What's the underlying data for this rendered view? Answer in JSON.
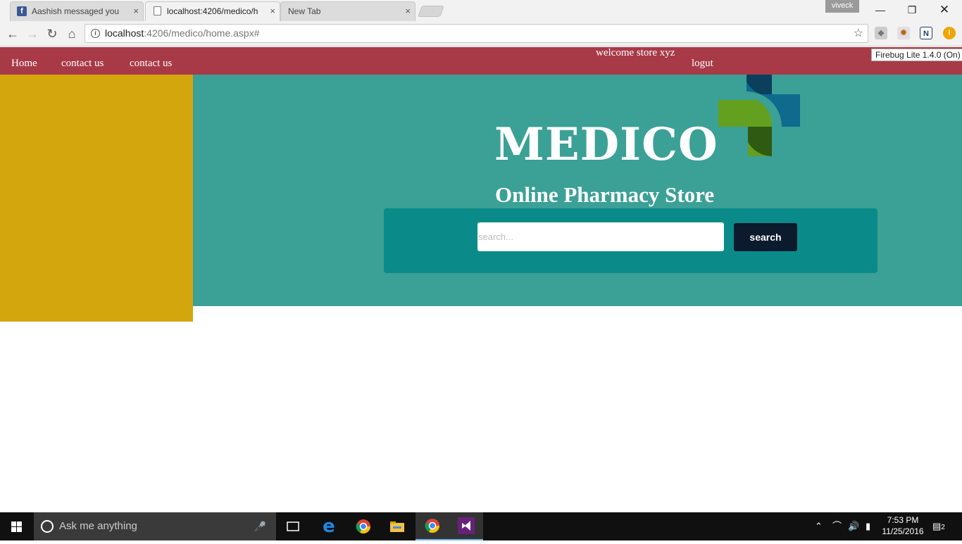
{
  "browser": {
    "tabs": [
      {
        "label": "Aashish messaged you",
        "icon": "facebook-icon"
      },
      {
        "label": "localhost:4206/medico/h",
        "icon": "page-icon"
      },
      {
        "label": "New Tab",
        "icon": ""
      }
    ],
    "close_glyph": "×",
    "profile_name": "viveck",
    "url_host": "localhost",
    "url_rest": ":4206/medico/home.aspx#",
    "extension_tooltip": "Firebug Lite 1.4.0 (On)"
  },
  "nav": {
    "items": [
      "Home",
      "contact us",
      "contact us"
    ],
    "welcome": "welcome store xyz",
    "logout": "logut"
  },
  "hero": {
    "logo_text": "MEDICO",
    "subtitle": "Online Pharmacy Store",
    "search_placeholder": "search...",
    "search_button": "search"
  },
  "taskbar": {
    "search_placeholder": "Ask me anything",
    "time": "7:53 PM",
    "date": "11/25/2016",
    "notification_count": "2"
  },
  "colors": {
    "navbar": "#a83a47",
    "sidebar": "#d4a60e",
    "hero": "#3ba096",
    "search_panel": "#0a8b89",
    "search_button": "#0b1a2d"
  }
}
